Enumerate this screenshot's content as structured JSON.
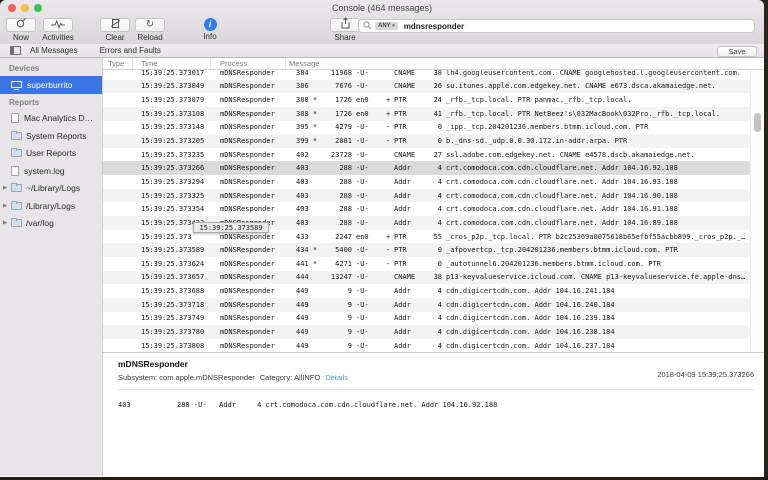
{
  "colors": {
    "selection_blue": "#3c76e4",
    "info_blue": "#2f7cf6",
    "link_blue": "#4aa0dd",
    "traffic_red": "#f55f58",
    "traffic_yellow": "#f6bd3e",
    "traffic_green": "#39c24b"
  },
  "window": {
    "title": "Console (464 messages)"
  },
  "toolbar": {
    "buttons": [
      {
        "label": "Now"
      },
      {
        "label": "Activities"
      },
      {
        "label": "Clear"
      },
      {
        "label": "Reload"
      },
      {
        "label": "Info"
      },
      {
        "label": "Share"
      }
    ],
    "search": {
      "scope": "ANY",
      "caret": "▾",
      "value": "mdnsresponder"
    }
  },
  "scopebar": {
    "tabs": [
      {
        "label": "All Messages"
      },
      {
        "label": "Errors and Faults"
      }
    ],
    "save_label": "Save"
  },
  "sidebar": {
    "sections": [
      {
        "header": "Devices",
        "items": [
          {
            "label": "superburrito",
            "icon": "device",
            "selected": true
          }
        ]
      },
      {
        "header": "Reports",
        "items": [
          {
            "label": "Mac Analytics D…",
            "icon": "doc"
          },
          {
            "label": "System Reports",
            "icon": "folder"
          },
          {
            "label": "User Reports",
            "icon": "folder"
          },
          {
            "label": "system.log",
            "icon": "doc"
          },
          {
            "label": "~/Library/Logs",
            "icon": "folder",
            "disclosure": true
          },
          {
            "label": "/Library/Logs",
            "icon": "folder",
            "disclosure": true
          },
          {
            "label": "/var/log",
            "icon": "folder",
            "disclosure": true
          }
        ]
      }
    ]
  },
  "table": {
    "columns": [
      "Type",
      "Time",
      "Process",
      "Message"
    ],
    "tooltip": "15:39:25.373589",
    "rows": [
      {
        "time": "15:39:25.373017",
        "process": "mDNSResponder",
        "q1": "384",
        "q2": "11968",
        "iface": "-U-",
        "flag": "",
        "rtype": "CNAME",
        "len": "38",
        "text": "lh4.googleusercontent.com. CNAME googlehosted.l.googleusercontent.com."
      },
      {
        "time": "15:39:25.373049",
        "process": "mDNSResponder",
        "q1": "386",
        "q2": "7676",
        "iface": "-U-",
        "flag": "",
        "rtype": "CNAME",
        "len": "26",
        "text": "su.itunes.apple.com.edgekey.net. CNAME e673.dsca.akamaiedge.net."
      },
      {
        "time": "15:39:25.373079",
        "process": "mDNSResponder",
        "q1": "388 *",
        "q2": "1726",
        "iface": "en0",
        "flag": "+",
        "rtype": "PTR",
        "len": "24",
        "text": "_rfb._tcp.local. PTR panmac._rfb._tcp.local."
      },
      {
        "time": "15:39:25.373108",
        "process": "mDNSResponder",
        "q1": "388 *",
        "q2": "1726",
        "iface": "en0",
        "flag": "+",
        "rtype": "PTR",
        "len": "41",
        "text": "_rfb._tcp.local. PTR NetBeez's\\032MacBook\\032Pro._rfb._tcp.local."
      },
      {
        "time": "15:39:25.373148",
        "process": "mDNSResponder",
        "q1": "395 *",
        "q2": "4279",
        "iface": "-U-",
        "flag": "-",
        "rtype": "PTR",
        "len": "0",
        "text": "_ipp._tcp.204201236.members.btmm.icloud.com. PTR"
      },
      {
        "time": "15:39:25.373205",
        "process": "mDNSResponder",
        "q1": "399 *",
        "q2": "2881",
        "iface": "-U-",
        "flag": "-",
        "rtype": "PTR",
        "len": "0",
        "text": "b._dns-sd._udp.0.0.30.172.in-addr.arpa. PTR"
      },
      {
        "time": "15:39:25.373235",
        "process": "mDNSResponder",
        "q1": "402",
        "q2": "23728",
        "iface": "-U-",
        "flag": "",
        "rtype": "CNAME",
        "len": "27",
        "text": "ssl.adobe.com.edgekey.net. CNAME e4578.dscb.akamaiedge.net."
      },
      {
        "time": "15:39:25.373266",
        "process": "mDNSResponder",
        "q1": "403",
        "q2": "288",
        "iface": "-U-",
        "flag": "",
        "rtype": "Addr",
        "len": "4",
        "text": "crt.comodoca.com.cdn.cloudflare.net. Addr 104.16.92.188",
        "selected": true
      },
      {
        "time": "15:39:25.373294",
        "process": "mDNSResponder",
        "q1": "403",
        "q2": "288",
        "iface": "-U-",
        "flag": "",
        "rtype": "Addr",
        "len": "4",
        "text": "crt.comodoca.com.cdn.cloudflare.net. Addr 104.16.93.188"
      },
      {
        "time": "15:39:25.373325",
        "process": "mDNSResponder",
        "q1": "403",
        "q2": "288",
        "iface": "-U-",
        "flag": "",
        "rtype": "Addr",
        "len": "4",
        "text": "crt.comodoca.com.cdn.cloudflare.net. Addr 104.16.90.188"
      },
      {
        "time": "15:39:25.373354",
        "process": "mDNSResponder",
        "q1": "403",
        "q2": "288",
        "iface": "-U-",
        "flag": "",
        "rtype": "Addr",
        "len": "4",
        "text": "crt.comodoca.com.cdn.cloudflare.net. Addr 104.16.91.188"
      },
      {
        "time": "15:39:25.373422",
        "process": "mDNSResponder",
        "q1": "403",
        "q2": "288",
        "iface": "-U-",
        "flag": "",
        "rtype": "Addr",
        "len": "4",
        "text": "crt.comodoca.com.cdn.cloudflare.net. Addr 104.16.89.188"
      },
      {
        "time": "15:39:25.373",
        "process": "mDNSResponder",
        "q1": "433",
        "q2": "2247",
        "iface": "en0",
        "flag": "+",
        "rtype": "PTR",
        "len": "55",
        "text": "_cros_p2p._tcp.local. PTR b2c25369a0075618b65efbf55acbb899._cros_p2p._…"
      },
      {
        "time": "15:39:25.373589",
        "process": "mDNSResponder",
        "q1": "434 *",
        "q2": "5400",
        "iface": "-U-",
        "flag": "-",
        "rtype": "PTR",
        "len": "0",
        "text": "_afpovertcp._tcp.204201236.members.btmm.icloud.com. PTR"
      },
      {
        "time": "15:39:25.373624",
        "process": "mDNSResponder",
        "q1": "441 *",
        "q2": "4271",
        "iface": "-U-",
        "flag": "-",
        "rtype": "PTR",
        "len": "0",
        "text": "_autotunnel6.204201236.members.btmm.icloud.com. PTR"
      },
      {
        "time": "15:39:25.373657",
        "process": "mDNSResponder",
        "q1": "444",
        "q2": "13247",
        "iface": "-U-",
        "flag": "",
        "rtype": "CNAME",
        "len": "38",
        "text": "p13-keyvalueservice.icloud.com. CNAME p13-keyvalueservice.fe.apple-dns…"
      },
      {
        "time": "15:39:25.373688",
        "process": "mDNSResponder",
        "q1": "449",
        "q2": "9",
        "iface": "-U-",
        "flag": "",
        "rtype": "Addr",
        "len": "4",
        "text": "cdn.digicertcdn.com. Addr 104.16.241.184"
      },
      {
        "time": "15:39:25.373718",
        "process": "mDNSResponder",
        "q1": "449",
        "q2": "9",
        "iface": "-U-",
        "flag": "",
        "rtype": "Addr",
        "len": "4",
        "text": "cdn.digicertcdn.com. Addr 104.16.240.184"
      },
      {
        "time": "15:39:25.373749",
        "process": "mDNSResponder",
        "q1": "449",
        "q2": "9",
        "iface": "-U-",
        "flag": "",
        "rtype": "Addr",
        "len": "4",
        "text": "cdn.digicertcdn.com. Addr 104.16.239.184"
      },
      {
        "time": "15:39:25.373780",
        "process": "mDNSResponder",
        "q1": "449",
        "q2": "9",
        "iface": "-U-",
        "flag": "",
        "rtype": "Addr",
        "len": "4",
        "text": "cdn.digicertcdn.com. Addr 104.16.238.184"
      },
      {
        "time": "15:39:25.373808",
        "process": "mDNSResponder",
        "q1": "449",
        "q2": "9",
        "iface": "-U-",
        "flag": "",
        "rtype": "Addr",
        "len": "4",
        "text": "cdn.digicertcdn.com. Addr 104.16.237.184"
      }
    ]
  },
  "detail": {
    "title": "mDNSResponder",
    "subsystem_label": "Subsystem:",
    "subsystem": "com.apple.mDNSResponder",
    "category_label": "Category:",
    "category": "AllINFO",
    "details_link": "Details",
    "timestamp": "2018-04-09 15:39:25.373266",
    "body": "403           288 -U-   Addr     4 crt.comodoca.com.cdn.cloudflare.net. Addr 104.16.92.188"
  }
}
